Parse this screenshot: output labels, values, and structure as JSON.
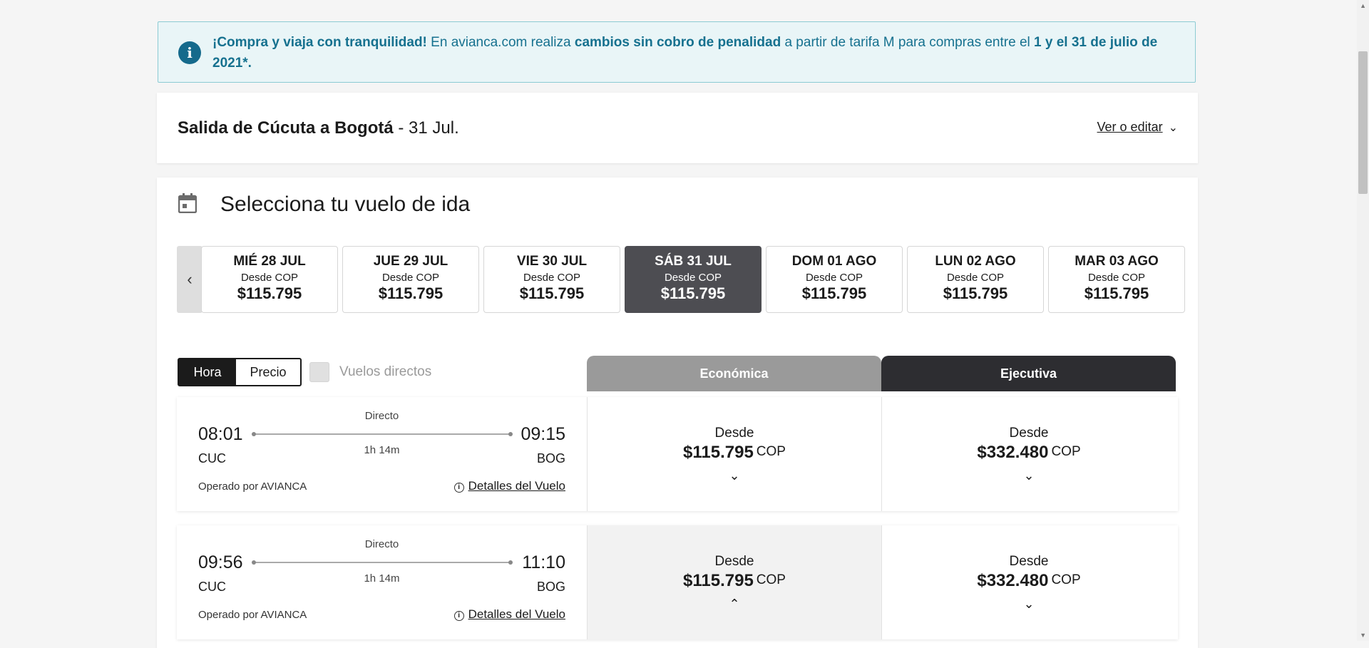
{
  "banner": {
    "bold_lead": "¡Compra y viaja con tranquilidad!",
    "text_1": " En avianca.com realiza ",
    "bold_mid": "cambios sin cobro de penalidad",
    "text_2": " a partir de tarifa M para compras entre el ",
    "bold_end": "1 y el 31 de julio de 2021*.",
    "icon": "info-icon"
  },
  "route": {
    "title_bold": "Salida de Cúcuta a Bogotá",
    "title_date": " - 31 Jul.",
    "edit_label": "Ver o editar"
  },
  "select": {
    "title": "Selecciona tu vuelo de ida"
  },
  "dates": [
    {
      "label": "MIÉ 28 JUL",
      "from": "Desde COP",
      "price": "$115.795"
    },
    {
      "label": "JUE 29 JUL",
      "from": "Desde COP",
      "price": "$115.795"
    },
    {
      "label": "VIE 30 JUL",
      "from": "Desde COP",
      "price": "$115.795"
    },
    {
      "label": "SÁB 31 JUL",
      "from": "Desde COP",
      "price": "$115.795",
      "selected": true
    },
    {
      "label": "DOM 01 AGO",
      "from": "Desde COP",
      "price": "$115.795"
    },
    {
      "label": "LUN 02 AGO",
      "from": "Desde COP",
      "price": "$115.795"
    },
    {
      "label": "MAR 03 AGO",
      "from": "Desde COP",
      "price": "$115.795"
    }
  ],
  "sort": {
    "hora": "Hora",
    "precio": "Precio",
    "direct_label": "Vuelos directos"
  },
  "cabins": {
    "eco": "Económica",
    "exe": "Ejecutiva"
  },
  "flights": [
    {
      "dep_time": "08:01",
      "arr_time": "09:15",
      "dep_code": "CUC",
      "arr_code": "BOG",
      "stops": "Directo",
      "duration": "1h 14m",
      "operated": "Operado por AVIANCA",
      "details": "Detalles del Vuelo",
      "eco": {
        "desde": "Desde",
        "price": "$115.795",
        "currency": "COP",
        "chevron": "⌄"
      },
      "exe": {
        "desde": "Desde",
        "price": "$332.480",
        "currency": "COP",
        "chevron": "⌄"
      }
    },
    {
      "dep_time": "09:56",
      "arr_time": "11:10",
      "dep_code": "CUC",
      "arr_code": "BOG",
      "stops": "Directo",
      "duration": "1h 14m",
      "operated": "Operado por AVIANCA",
      "details": "Detalles del Vuelo",
      "eco": {
        "desde": "Desde",
        "price": "$115.795",
        "currency": "COP",
        "chevron": "⌃"
      },
      "exe": {
        "desde": "Desde",
        "price": "$332.480",
        "currency": "COP",
        "chevron": "⌄"
      }
    }
  ],
  "colors": {
    "banner_text": "#16718f",
    "selected_date": "#4d4d52",
    "eco_tab": "#9a9a9a",
    "exe_tab": "#2d2d31"
  }
}
